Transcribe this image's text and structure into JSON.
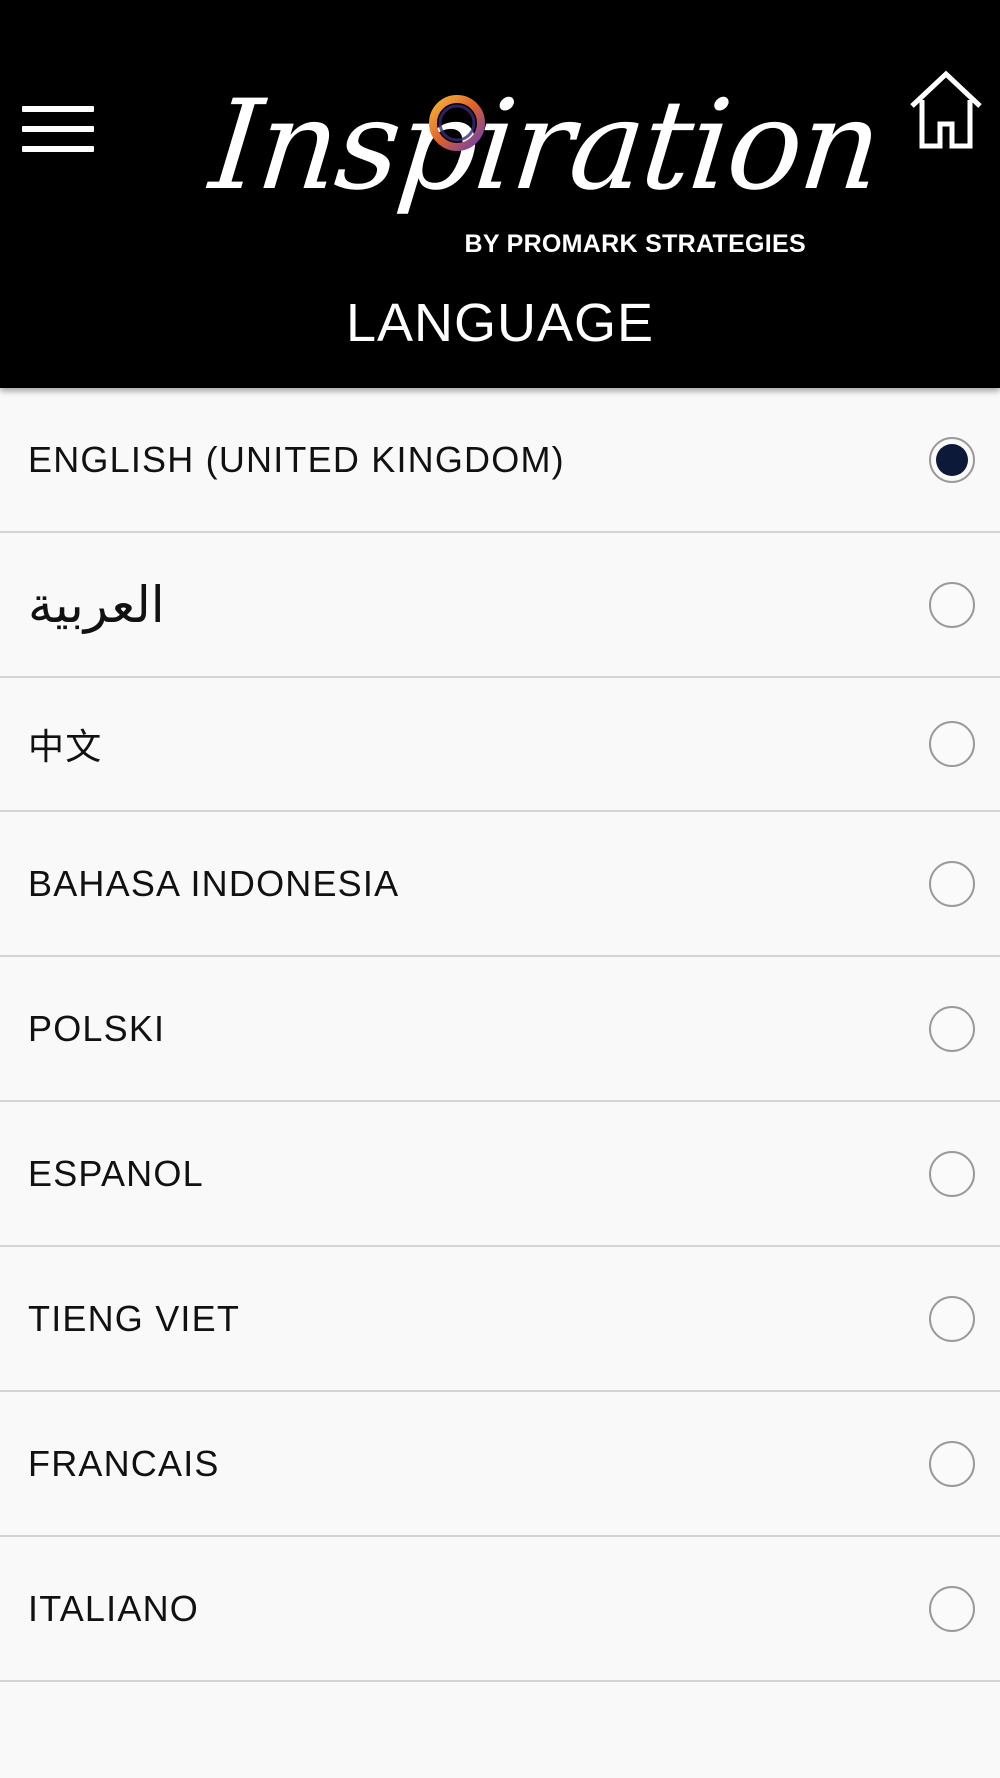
{
  "header": {
    "menu_icon": "hamburger-menu-icon",
    "home_icon": "home-icon",
    "logo": {
      "script_text": "Inspiration",
      "tagline": "BY PROMARK STRATEGIES"
    },
    "title": "LANGUAGE",
    "background_color": "#000000",
    "text_color": "#ffffff"
  },
  "languages": [
    {
      "label": "ENGLISH (UNITED KINGDOM)",
      "selected": true
    },
    {
      "label": "العربية",
      "selected": false
    },
    {
      "label": "中文",
      "selected": false
    },
    {
      "label": "BAHASA INDONESIA",
      "selected": false
    },
    {
      "label": "POLSKI",
      "selected": false
    },
    {
      "label": "ESPANOL",
      "selected": false
    },
    {
      "label": "TIENG VIET",
      "selected": false
    },
    {
      "label": "FRANCAIS",
      "selected": false
    },
    {
      "label": "ITALIANO",
      "selected": false
    }
  ],
  "colors": {
    "radio_selected": "#0c1938",
    "radio_border": "#9a9a9a",
    "list_background": "#f9f9f9",
    "divider": "#d4d4d4"
  }
}
